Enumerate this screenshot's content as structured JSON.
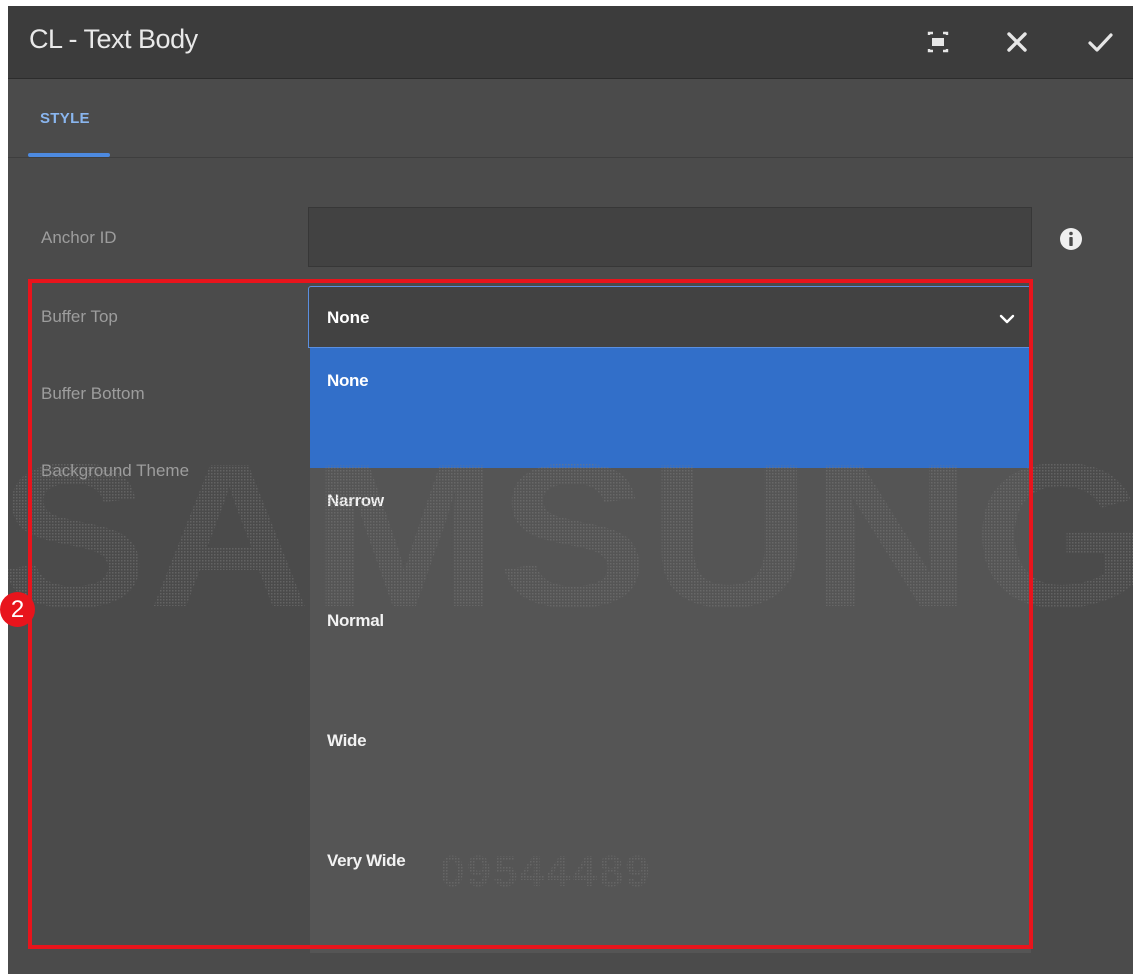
{
  "dialog": {
    "title": "CL - Text Body",
    "icons": {
      "fullscreen": "fullscreen-icon",
      "close": "close-icon",
      "done": "check-icon"
    }
  },
  "tabs": [
    {
      "label": "STYLE",
      "active": true
    }
  ],
  "form": {
    "anchor_id": {
      "label": "Anchor ID",
      "value": "",
      "info_icon": "info-icon"
    },
    "buffer_top": {
      "label": "Buffer Top",
      "selected": "None",
      "options": [
        "None",
        "Narrow",
        "Normal",
        "Wide",
        "Very Wide"
      ]
    },
    "buffer_bottom": {
      "label": "Buffer Bottom"
    },
    "background_theme": {
      "label": "Background Theme"
    }
  },
  "annotation": {
    "step_number": "2"
  },
  "watermark": {
    "brand": "SAMSUNG",
    "code": "09544489"
  },
  "colors": {
    "accent": "#326fc9",
    "tab_active": "#8ab6ef",
    "highlight": "#e8141c",
    "panel": "#4b4b4b",
    "titlebar": "#3c3c3c"
  }
}
